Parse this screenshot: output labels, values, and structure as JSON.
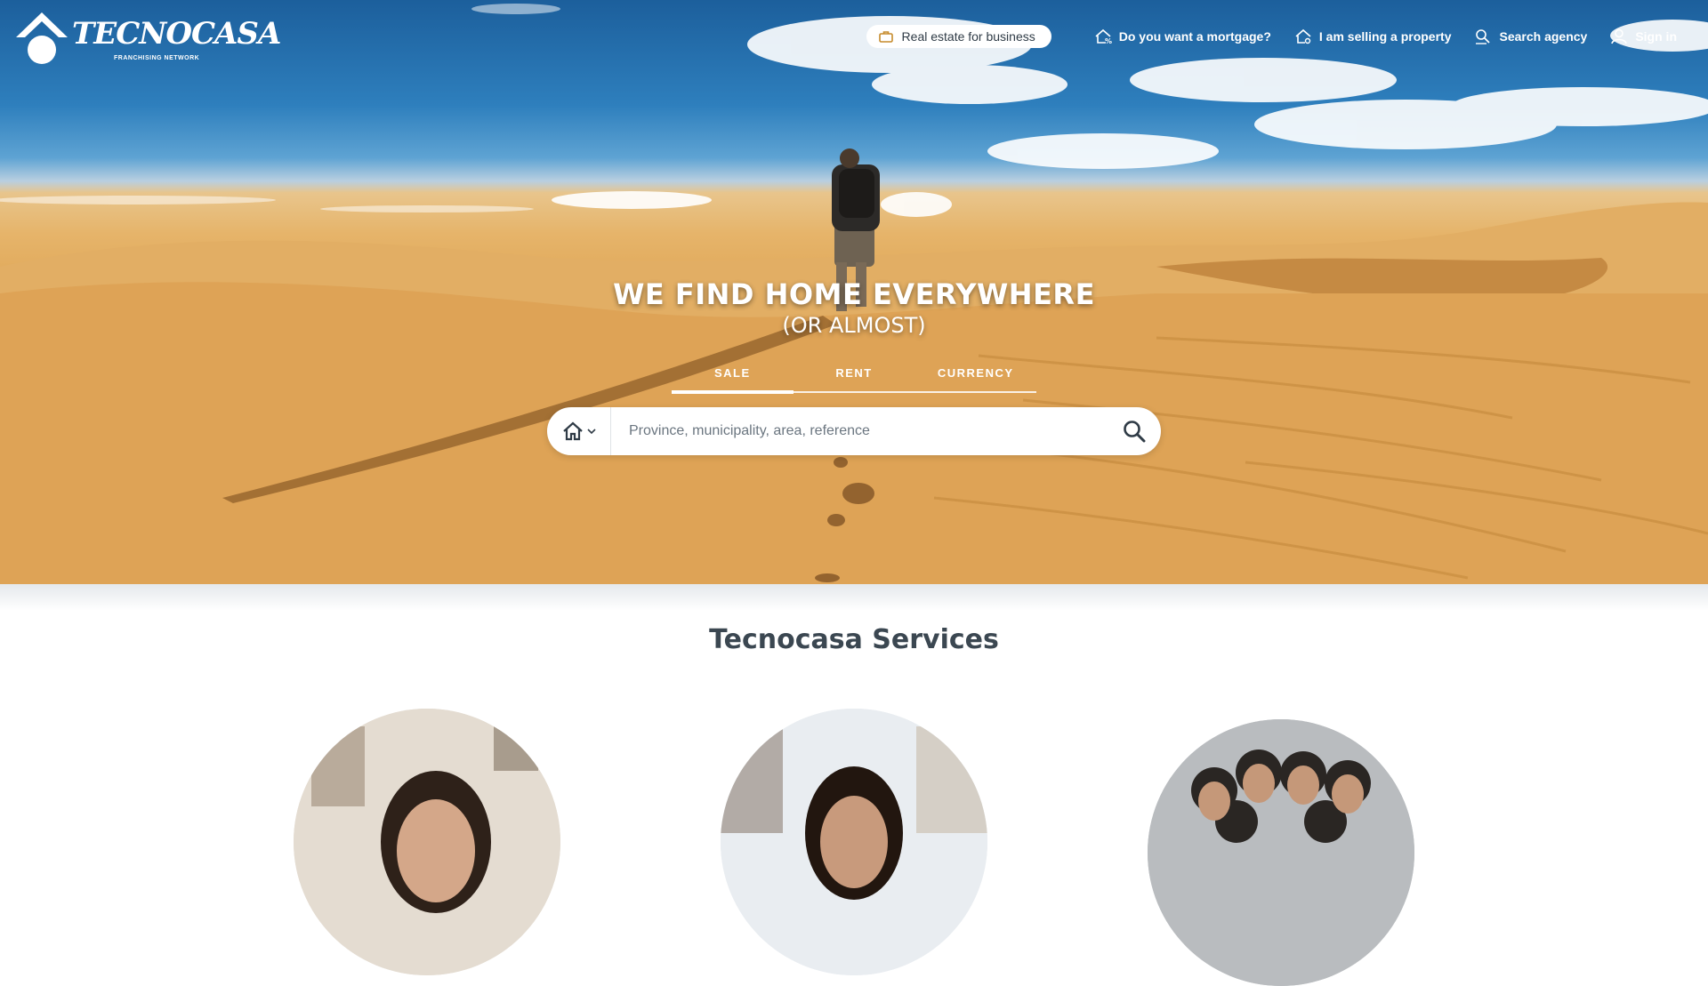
{
  "brand": {
    "name": "TECNOCASA",
    "tagline": "FRANCHISING NETWORK",
    "registered": "®"
  },
  "topnav": {
    "business": {
      "label": "Real estate for business",
      "icon": "briefcase-icon"
    },
    "links": [
      {
        "label": "Do you want a mortgage?",
        "icon": "house-percent-icon"
      },
      {
        "label": "I am selling a property",
        "icon": "house-tag-icon"
      },
      {
        "label": "Search agency",
        "icon": "search-person-icon"
      },
      {
        "label": "Sign in",
        "icon": "user-icon"
      }
    ]
  },
  "hero": {
    "title": "WE FIND HOME EVERYWHERE",
    "subtitle": "(OR ALMOST)"
  },
  "tabs": [
    {
      "label": "SALE",
      "active": true
    },
    {
      "label": "RENT",
      "active": false
    },
    {
      "label": "CURRENCY",
      "active": false
    }
  ],
  "search": {
    "placeholder": "Province, municipality, area, reference",
    "type_icon": "home-icon",
    "go_icon": "search-icon"
  },
  "services": {
    "title": "Tecnocasa Services"
  },
  "colors": {
    "accent": "#c58a2a",
    "text_dark": "#3b4751",
    "white": "#ffffff"
  }
}
